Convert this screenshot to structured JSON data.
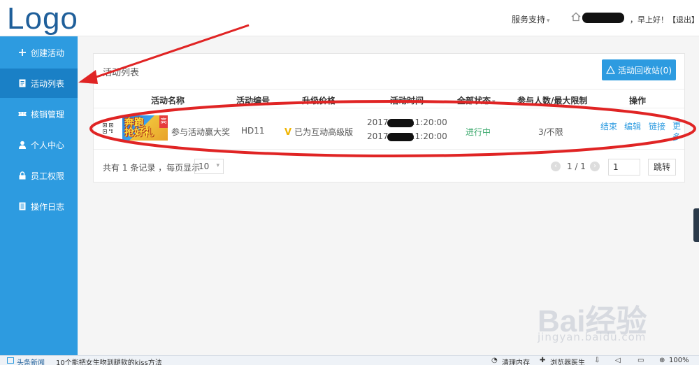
{
  "header": {
    "logo": "Logo",
    "service_menu": "服务支持",
    "greeting": "，早上好！【退出】"
  },
  "sidebar": {
    "items": [
      {
        "label": "创建活动",
        "icon": "plus-icon"
      },
      {
        "label": "活动列表",
        "icon": "list-icon",
        "active": true
      },
      {
        "label": "核销管理",
        "icon": "ticket-icon"
      },
      {
        "label": "个人中心",
        "icon": "user-icon"
      },
      {
        "label": "员工权限",
        "icon": "lock-icon"
      },
      {
        "label": "操作日志",
        "icon": "log-icon"
      }
    ]
  },
  "panel": {
    "title": "活动列表",
    "recycle_button": "活动回收站(0)",
    "columns": [
      "活动名称",
      "活动编号",
      "升级价格",
      "活动时间",
      "全部状态",
      "参与人数/最大限制",
      "操作"
    ],
    "row": {
      "thumb_text_1": "奔跑",
      "thumb_text_2": "抢好礼",
      "thumb_tag": "高",
      "name": "参与活动赢大奖",
      "code": "HD11",
      "upgrade_mark": "V",
      "upgrade": "已为互动高级版",
      "time_start_prefix": "2017-",
      "time_start_suffix": "11:20:00",
      "time_end_prefix": "2017-",
      "time_end_suffix": "11:20:00",
      "status": "进行中",
      "participants": "3/不限",
      "ops": {
        "end": "结束",
        "edit": "编辑",
        "link": "链接",
        "more": "更多"
      }
    },
    "pagination": {
      "total_prefix": "共有",
      "total_count": "1",
      "total_suffix": "条记录 ，每页显示",
      "page_size": "10",
      "page_info": "1 / 1",
      "page_input": "1",
      "jump": "跳转"
    }
  },
  "statusbar": {
    "news_label": "头条新闻",
    "headline": "10个能把女生吻到腿软的kiss方法",
    "clean_memory": "清理内存",
    "browser_doctor": "浏览器医生",
    "zoom": "100%"
  },
  "watermark": {
    "brand": "Bai经验",
    "url": "jingyan.baidu.com"
  },
  "colors": {
    "accent": "#2d9be0",
    "sidebar_active": "#1a80c6",
    "annotation_red": "#e02424",
    "status_green": "#39a86b"
  }
}
